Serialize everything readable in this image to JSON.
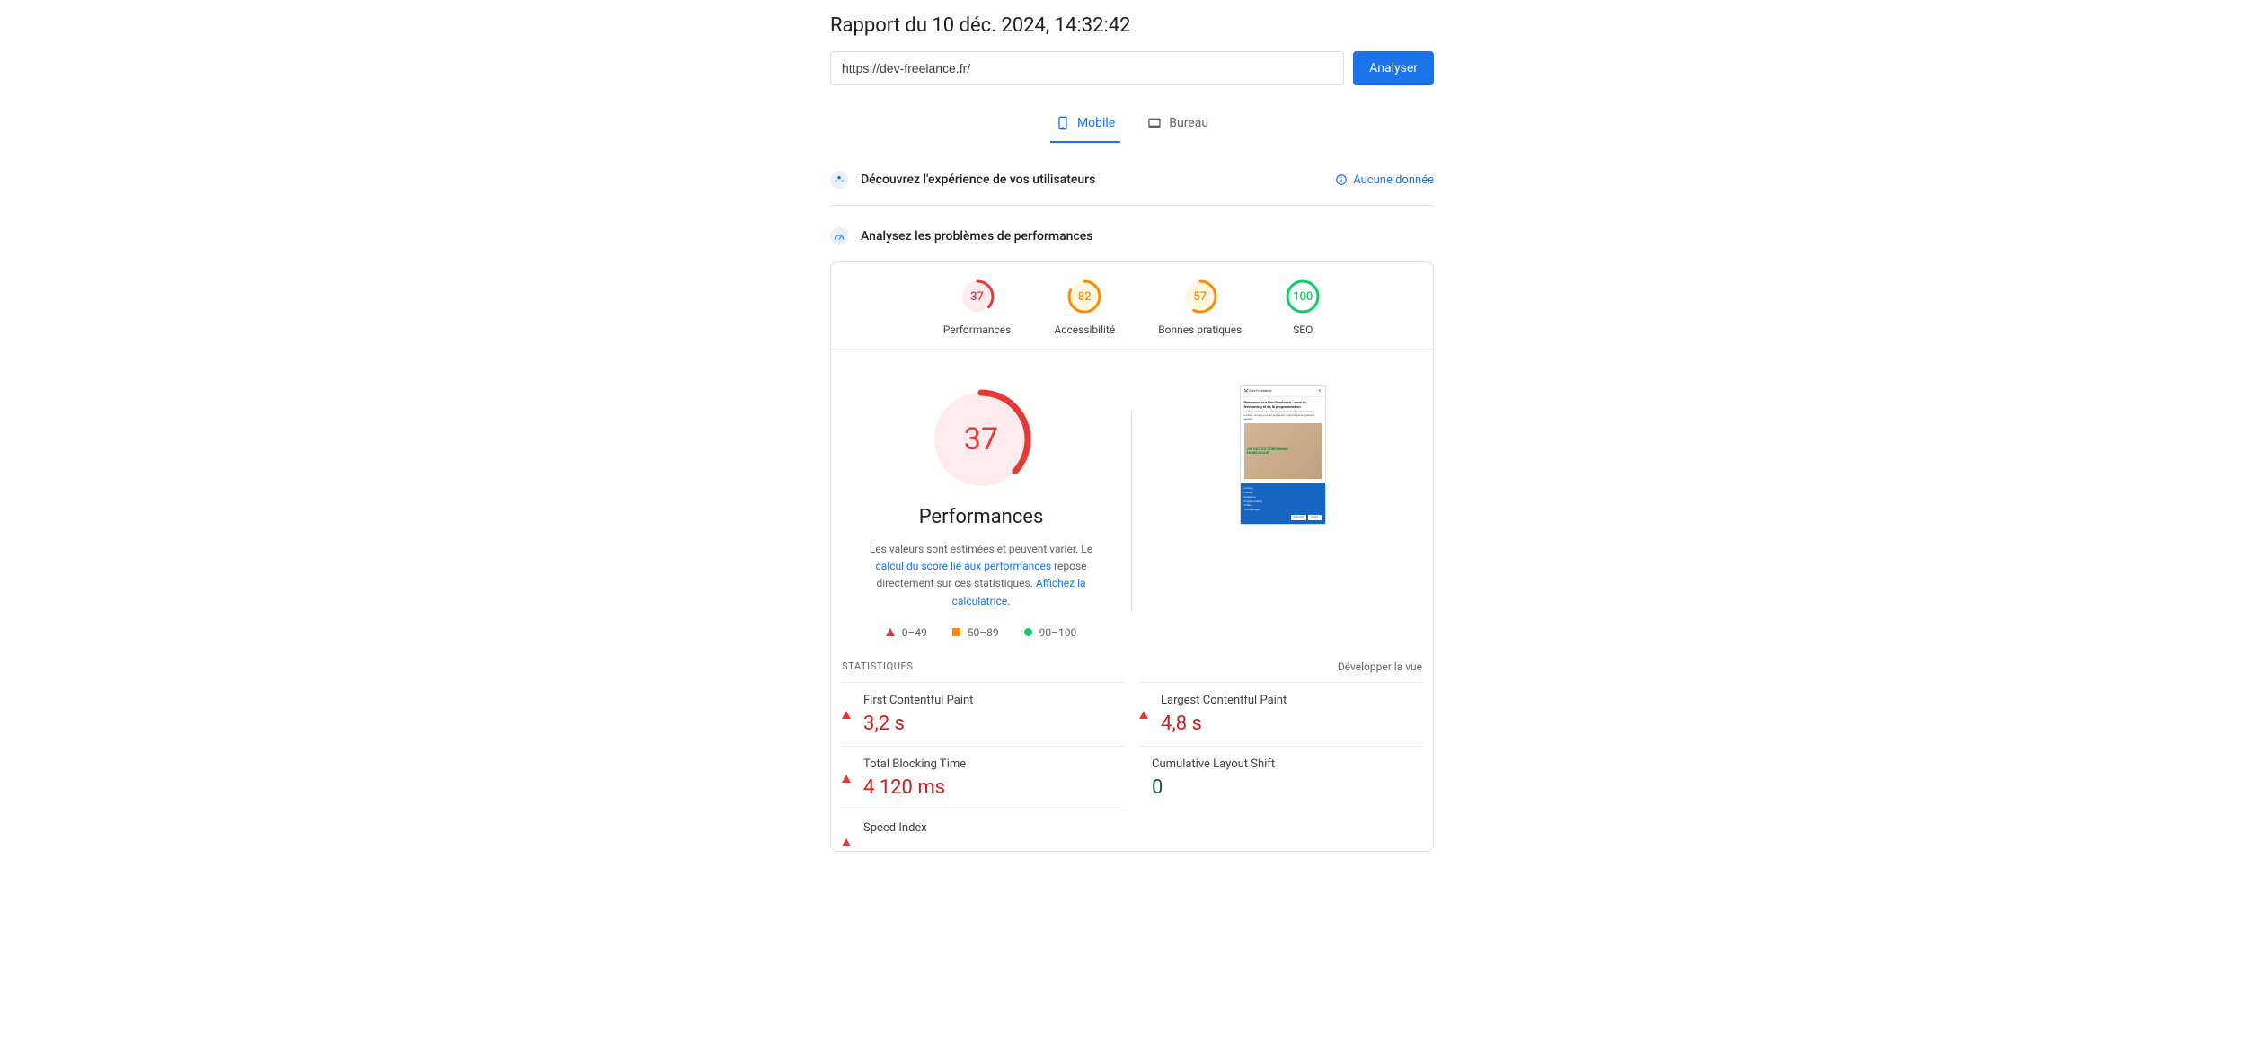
{
  "title": "Rapport du 10 déc. 2024, 14:32:42",
  "url_input": {
    "value": "https://dev-freelance.fr/"
  },
  "analyze_label": "Analyser",
  "tabs": {
    "mobile": "Mobile",
    "desktop": "Bureau"
  },
  "section_users": "Découvrez l'expérience de vos utilisateurs",
  "no_data": "Aucune donnée",
  "section_perf": "Analysez les problèmes de performances",
  "gauges": {
    "performance": {
      "label": "Performances",
      "score": 37,
      "color": "red"
    },
    "accessibility": {
      "label": "Accessibilité",
      "score": 82,
      "color": "org"
    },
    "best_practices": {
      "label": "Bonnes pratiques",
      "score": 57,
      "color": "org"
    },
    "seo": {
      "label": "SEO",
      "score": 100,
      "color": "grn"
    }
  },
  "big": {
    "score": 37,
    "title": "Performances"
  },
  "desc": {
    "pre": "Les valeurs sont estimées et peuvent varier. Le ",
    "link1": "calcul du score lié aux performances",
    "mid": " repose directement sur ces statistiques. ",
    "link2": "Affichez la calculatrice",
    "post": "."
  },
  "legend": {
    "r0": "0–49",
    "r1": "50–89",
    "r2": "90–100"
  },
  "thumb": {
    "brand": "Dev-Freelance",
    "h": "Bienvenue sur Dev-Freelance : vivre du freelancing et de la programmation",
    "p": "Ce blog s'adresse aux développeur(se)s qui veulent devenir meilleur chaque jour, en apprenant la technique et quelques secrets",
    "img_txt": "J'AI FAIT DU COWORKING EN BELGIQUE",
    "blue_lines": [
      "Le blog",
      "L'auteur",
      "Freelance",
      "Programmation",
      "Vidéos",
      "Témoignages"
    ],
    "btn1": "S'abonner",
    "btn2": "Contact"
  },
  "stats": {
    "title": "STATISTIQUES",
    "expand": "Développer la vue"
  },
  "metrics": {
    "left": [
      {
        "name": "First Contentful Paint",
        "value": "3,2 s",
        "status": "red"
      },
      {
        "name": "Total Blocking Time",
        "value": "4 120 ms",
        "status": "red"
      },
      {
        "name": "Speed Index",
        "value": "",
        "status": "red"
      }
    ],
    "right": [
      {
        "name": "Largest Contentful Paint",
        "value": "4,8 s",
        "status": "red"
      },
      {
        "name": "Cumulative Layout Shift",
        "value": "0",
        "status": "grn"
      }
    ]
  }
}
